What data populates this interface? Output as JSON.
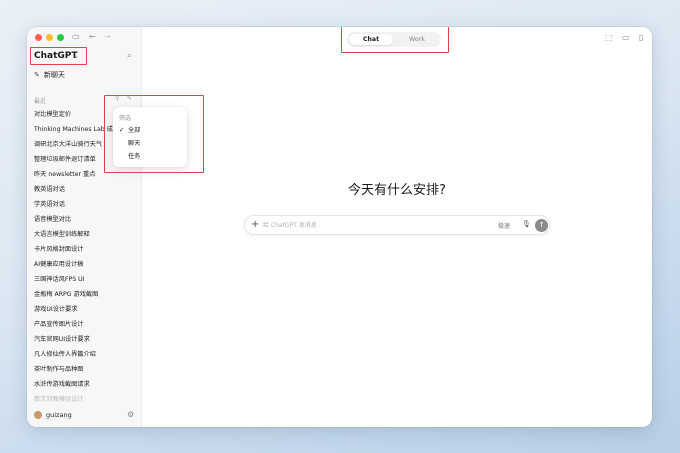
{
  "colors": {
    "highlight_border": "#e0424c",
    "sidebar_bg": "#f7f7f8",
    "send_button": "#8b8b8b"
  },
  "sidebar": {
    "brand": "ChatGPT",
    "brand_chevron": "⌄",
    "search_icon": "⌕",
    "new_chat_icon": "✎",
    "new_chat_label": "新聊天",
    "recent_label": "最近",
    "filter_icon": "⚲",
    "edit_icon": "✎",
    "history": [
      "对比模型定价",
      "Thinking Machines Lab 成",
      "调研北京大洋山骑行天气",
      "整理垃圾邮件退订清单",
      "昨天 newsletter 重点",
      "教英语对话",
      "学英语对话",
      "语音模型对比",
      "大语言模型训练解释",
      "卡片风格封面设计",
      "AI健康应用设计稿",
      "三国神话风FPS UI",
      "金瓶梅 ARPG 游戏截图",
      "游戏UI设计要求",
      "产品宣传图片设计",
      "汽车官网UI设计要求",
      "凡人修仙传人界篇介绍",
      "茶叶制作与品种图",
      "水浒传游戏截图请求",
      "散文封面模组设计"
    ],
    "user_name": "guizang",
    "settings_icon": "⚙"
  },
  "filter_menu": {
    "title": "筛选",
    "items": [
      {
        "label": "全部",
        "check": "✓"
      },
      {
        "label": "聊天",
        "check": ""
      },
      {
        "label": "任务",
        "check": ""
      }
    ]
  },
  "titlebar": {
    "sidebar_toggle_icon": "▭",
    "back_icon": "←",
    "forward_icon": "→"
  },
  "mode_switch": {
    "chat": "Chat",
    "work": "Work"
  },
  "top_right": {
    "icon1": "⬚",
    "icon2": "▭",
    "icon3": "▯"
  },
  "main": {
    "headline": "今天有什么安排?",
    "composer": {
      "plus": "+",
      "placeholder": "给 ChatGPT 发消息",
      "speed_label": "极速",
      "mic_icon": "🎙",
      "send_icon": "↑"
    }
  }
}
